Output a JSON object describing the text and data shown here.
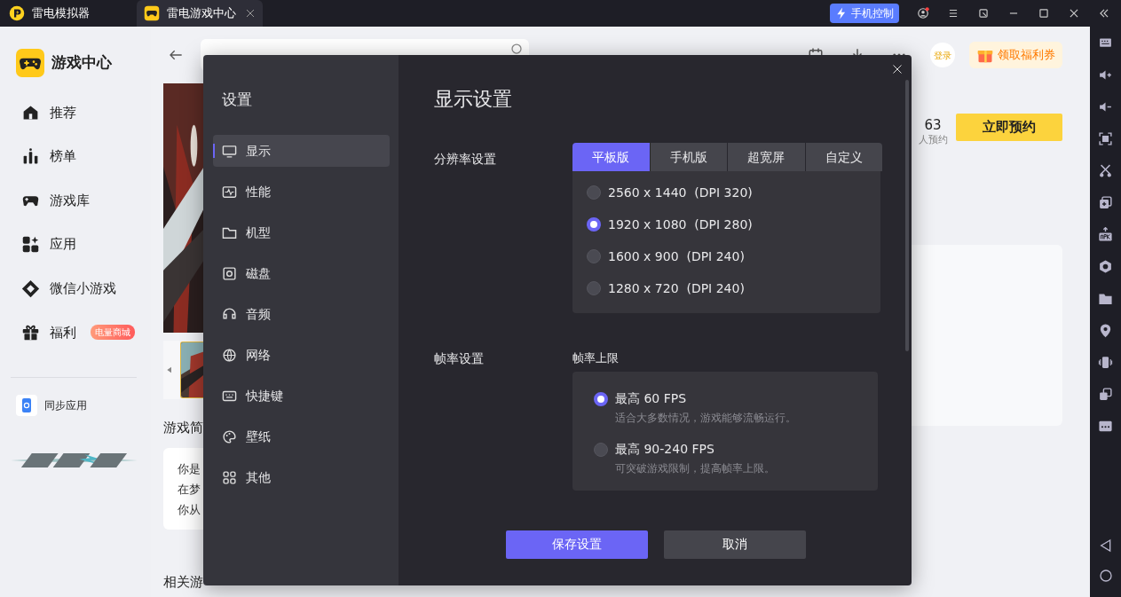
{
  "title_bar": {
    "app_name": "雷电模拟器",
    "tabs": [
      {
        "label": "雷电游戏中心",
        "selected": true
      }
    ],
    "phone_control_button": "手机控制"
  },
  "sidebar": {
    "title": "游戏中心",
    "items": [
      {
        "label": "推荐",
        "kind": "home"
      },
      {
        "label": "榜单",
        "kind": "chart"
      },
      {
        "label": "游戏库",
        "kind": "gamepad"
      },
      {
        "label": "应用",
        "kind": "apps"
      },
      {
        "label": "微信小游戏",
        "kind": "diamond"
      },
      {
        "label": "福利",
        "kind": "gift",
        "badge": "电量商城"
      }
    ],
    "sync_app": "同步应用"
  },
  "main": {
    "login_button": "登录",
    "coupon_button": "领取福利券",
    "reserve_count": "63",
    "reserve_label": "人预约",
    "reserve_button": "立即预约",
    "intro_heading": "游戏简",
    "intro_lines": [
      "你是",
      "在梦",
      "你从"
    ],
    "related_heading": "相关游"
  },
  "settings_dialog": {
    "title": "设置",
    "menu": [
      {
        "label": "显示",
        "kind": "display",
        "selected": true
      },
      {
        "label": "性能",
        "kind": "performance",
        "selected": false
      },
      {
        "label": "机型",
        "kind": "model",
        "selected": false
      },
      {
        "label": "磁盘",
        "kind": "disk",
        "selected": false
      },
      {
        "label": "音频",
        "kind": "audio",
        "selected": false
      },
      {
        "label": "网络",
        "kind": "network",
        "selected": false
      },
      {
        "label": "快捷键",
        "kind": "keyboard",
        "selected": false
      },
      {
        "label": "壁纸",
        "kind": "wallpaper",
        "selected": false
      },
      {
        "label": "其他",
        "kind": "other",
        "selected": false
      }
    ],
    "heading": "显示设置",
    "resolution": {
      "label": "分辨率设置",
      "tabs": [
        {
          "label": "平板版",
          "selected": true
        },
        {
          "label": "手机版",
          "selected": false
        },
        {
          "label": "超宽屏",
          "selected": false
        },
        {
          "label": "自定义",
          "selected": false
        }
      ],
      "options": [
        {
          "label": "2560 x 1440  (DPI 320)",
          "selected": false
        },
        {
          "label": "1920 x 1080  (DPI 280)",
          "selected": true
        },
        {
          "label": "1600 x 900  (DPI 240)",
          "selected": false
        },
        {
          "label": "1280 x 720  (DPI 240)",
          "selected": false
        }
      ]
    },
    "frame_rate": {
      "label": "帧率设置",
      "sublabel": "帧率上限",
      "options": [
        {
          "label": "最高 60 FPS",
          "description": "适合大多数情况，游戏能够流畅运行。",
          "selected": true
        },
        {
          "label": "最高 90-240 FPS",
          "description": "可突破游戏限制，提高帧率上限。",
          "selected": false
        }
      ]
    },
    "buttons": [
      {
        "label": "保存设置",
        "kind": "primary"
      },
      {
        "label": "取消",
        "kind": "secondary"
      }
    ]
  }
}
